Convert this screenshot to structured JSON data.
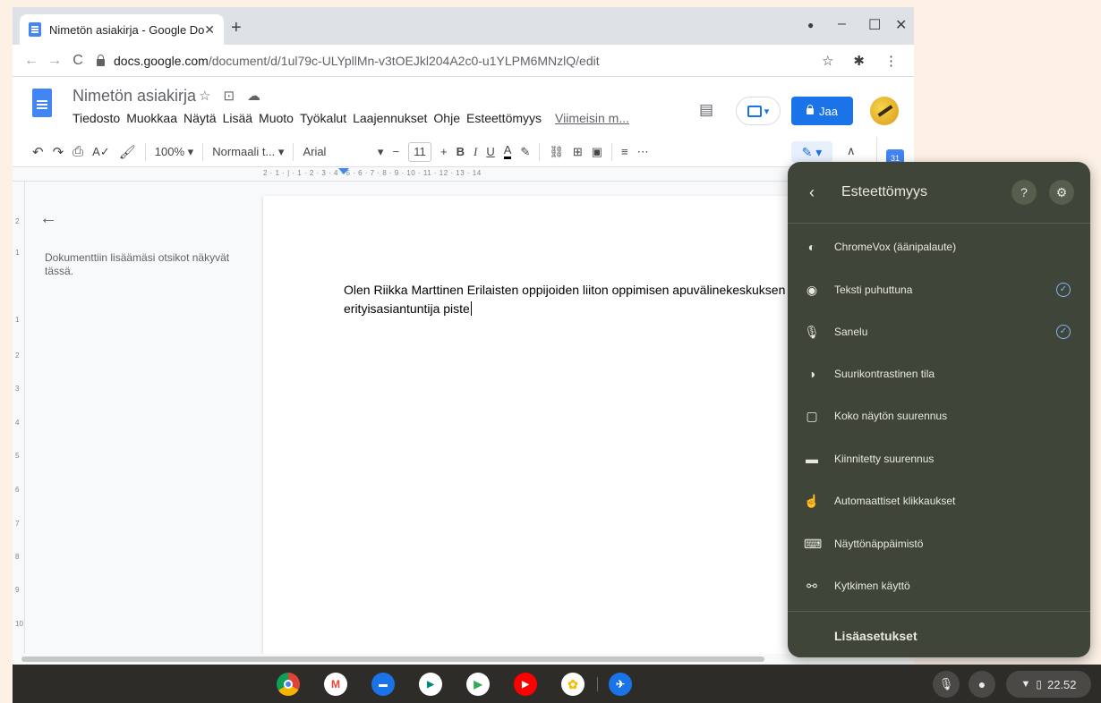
{
  "browser": {
    "tab_title": "Nimetön asiakirja - Google Docs",
    "tab_close": "✕",
    "new_tab": "+",
    "url_host": "docs.google.com",
    "url_path": "/document/d/1ul79c-ULYpllMn-v3tOEJkl204A2c0-u1YLPM6MNzlQ/edit",
    "back": "←",
    "forward": "→",
    "reload": "C",
    "star": "☆",
    "extensions": "✱",
    "menu": "⋮",
    "minimize": "–",
    "maximize": "☐",
    "close": "✕",
    "profile_dot": "●"
  },
  "docs": {
    "title": "Nimetön asiakirja",
    "title_icons": [
      "☆",
      "⊡",
      "☁"
    ],
    "menu": [
      "Tiedosto",
      "Muokkaa",
      "Näytä",
      "Lisää",
      "Muoto",
      "Työkalut",
      "Laajennukset",
      "Ohje",
      "Esteettömyys"
    ],
    "last_edit": "Viimeisin m...",
    "share_label": "Jaa",
    "comments_icon": "▤",
    "present_caret": "▾"
  },
  "toolbar": {
    "undo": "↶",
    "redo": "↷",
    "print": "⎙",
    "spell": "A✓",
    "paint": "🖌",
    "zoom": "100%",
    "style": "Normaali t...",
    "font": "Arial",
    "minus": "−",
    "size": "11",
    "plus": "+",
    "bold": "B",
    "italic": "I",
    "underline": "U",
    "color": "A",
    "highlight": "✎",
    "link": "⛓",
    "comment": "⊞",
    "image": "▣",
    "align": "≡",
    "more": "⋯",
    "edit_mode": "✎ ▾",
    "collapse": "∧",
    "calendar": "31",
    "dropdown": "▾"
  },
  "ruler": {
    "scale": "2 · 1 · | · 1 · 2 · 3 · 4 · 5 · 6 · 7 · 8 · 9 · 10 · 11 · 12 · 13 · 14",
    "vertical": [
      "2",
      "1",
      "1",
      "2",
      "3",
      "4",
      "5",
      "6",
      "7",
      "8",
      "9",
      "10"
    ]
  },
  "outline": {
    "back": "←",
    "empty_text": "Dokumenttiin lisäämäsi otsikot näkyvät tässä."
  },
  "document": {
    "body": "Olen Riikka Marttinen Erilaisten oppijoiden liiton oppimisen apuvälinekeskuksen erityisasiantuntija piste"
  },
  "a11y_panel": {
    "back": "‹",
    "title": "Esteettömyys",
    "help_icon": "?",
    "settings_icon": "⚙",
    "items": [
      {
        "label": "ChromeVox (äänipalaute)",
        "icon": "◐",
        "checked": false
      },
      {
        "label": "Teksti puhuttuna",
        "icon": "◉",
        "checked": true
      },
      {
        "label": "Sanelu",
        "icon": "🎙",
        "checked": true
      },
      {
        "label": "Suurikontrastinen tila",
        "icon": "◑",
        "checked": false
      },
      {
        "label": "Koko näytön suurennus",
        "icon": "▢",
        "checked": false
      },
      {
        "label": "Kiinnitetty suurennus",
        "icon": "▬",
        "checked": false
      },
      {
        "label": "Automaattiset klikkaukset",
        "icon": "☝",
        "checked": false
      },
      {
        "label": "Näyttönäppäimistö",
        "icon": "⌨",
        "checked": false
      },
      {
        "label": "Kytkimen käyttö",
        "icon": "⚯",
        "checked": false
      }
    ],
    "check_glyph": "✓",
    "more_settings": "Lisäasetukset"
  },
  "shelf": {
    "apps": [
      {
        "name": "chrome",
        "glyph": "",
        "color": "#db4437"
      },
      {
        "name": "gmail",
        "glyph": "M",
        "color": "#ffffff"
      },
      {
        "name": "files",
        "glyph": "▬",
        "color": "#1a73e8"
      },
      {
        "name": "meet",
        "glyph": "▶",
        "color": "#00897b"
      },
      {
        "name": "play-store",
        "glyph": "▶",
        "color": "#ffffff"
      },
      {
        "name": "youtube",
        "glyph": "▶",
        "color": "#ff0000"
      },
      {
        "name": "photos",
        "glyph": "✿",
        "color": "#ffffff"
      },
      {
        "name": "launcher-app",
        "glyph": "✈",
        "color": "#1a73e8"
      }
    ],
    "mic": "🎙",
    "stop": "●",
    "wifi": "▼",
    "battery": "▯",
    "time": "22.52"
  },
  "colors": {
    "accent": "#1a73e8",
    "panel_bg": "#3f4639",
    "shelf_bg": "#2d2c28",
    "page_bg": "#fdf1e6"
  }
}
